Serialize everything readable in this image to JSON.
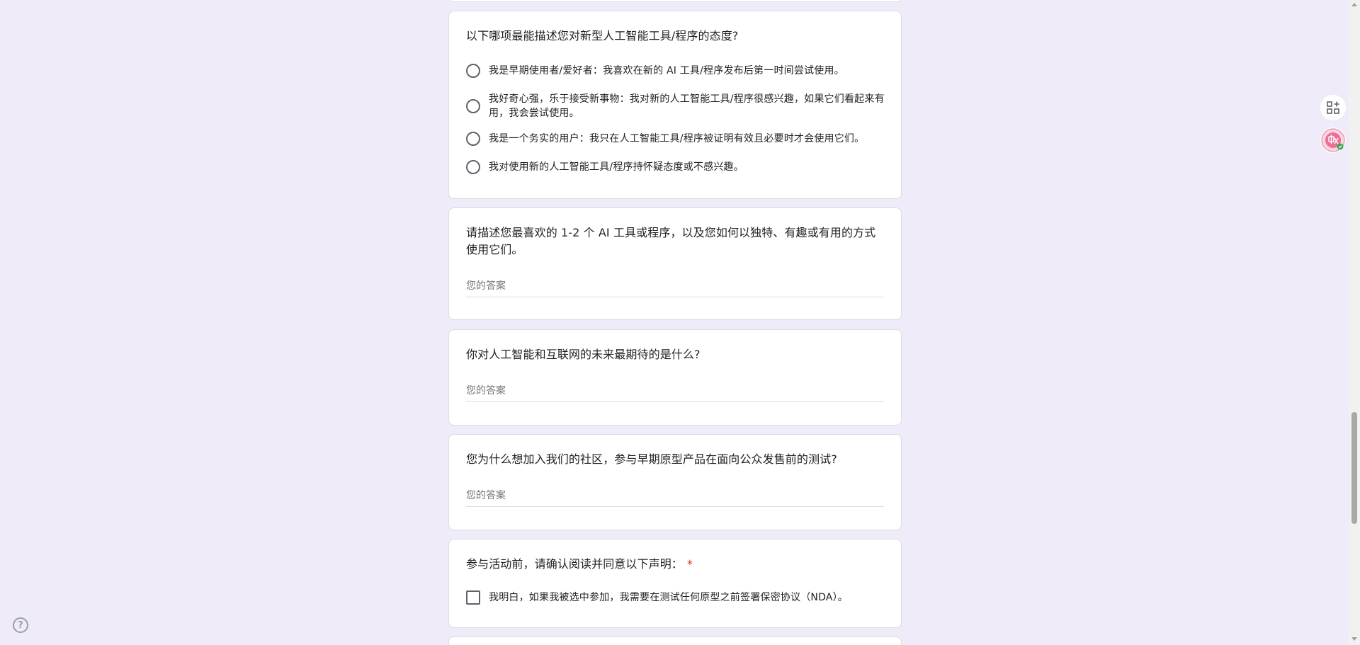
{
  "q_attitude": {
    "title": "以下哪项最能描述您对新型人工智能工具/程序的态度?",
    "options": [
      "我是早期使用者/爱好者：我喜欢在新的 AI 工具/程序发布后第一时间尝试使用。",
      "我好奇心强，乐于接受新事物：我对新的人工智能工具/程序很感兴趣，如果它们看起来有用，我会尝试使用。",
      "我是一个务实的用户：我只在人工智能工具/程序被证明有效且必要时才会使用它们。",
      "我对使用新的人工智能工具/程序持怀疑态度或不感兴趣。"
    ]
  },
  "q_favorite_tools": {
    "title": "请描述您最喜欢的 1-2 个 AI 工具或程序，以及您如何以独特、有趣或有用的方式使用它们。",
    "placeholder": "您的答案"
  },
  "q_future": {
    "title": "你对人工智能和互联网的未来最期待的是什么?",
    "placeholder": "您的答案"
  },
  "q_why_join": {
    "title": "您为什么想加入我们的社区，参与早期原型产品在面向公众发售前的测试?",
    "placeholder": "您的答案"
  },
  "q_consent": {
    "title": "参与活动前，请确认阅读并同意以下声明：",
    "required_mark": "*",
    "checkbox_label": "我明白，如果我被选中参加，我需要在测试任何原型之前签署保密协议（NDA）。"
  },
  "side_tools": {
    "addon_icon": "apps-add-icon",
    "translate_icon": "translate-icon"
  },
  "help": {
    "icon": "help-icon",
    "glyph": "?"
  },
  "colors": {
    "background": "#f0ebf8",
    "card": "#ffffff",
    "border": "#dadce0",
    "required": "#d93025"
  }
}
